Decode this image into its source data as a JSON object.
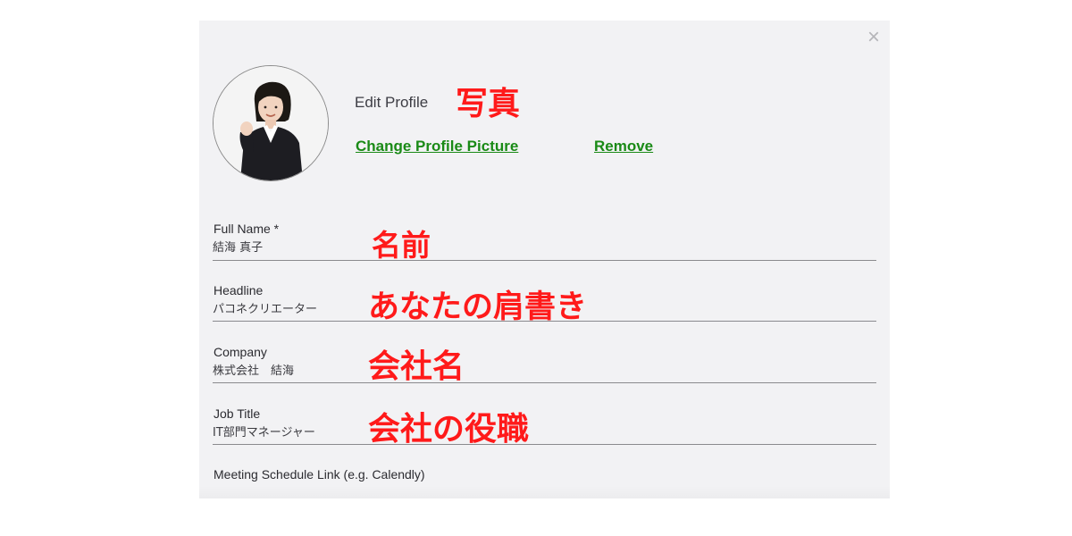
{
  "modal": {
    "close_symbol": "×",
    "title": "Edit Profile",
    "photo_annotation": "写真",
    "change_picture_label": "Change Profile Picture",
    "remove_label": "Remove"
  },
  "fields": [
    {
      "label": "Full Name *",
      "value": "結海 真子",
      "annotation": "名前"
    },
    {
      "label": "Headline",
      "value": "パコネクリエーター",
      "annotation": "あなたの肩書き"
    },
    {
      "label": "Company",
      "value": "株式会社　結海",
      "annotation": "会社名"
    },
    {
      "label": "Job Title",
      "value": "IT部門マネージャー",
      "annotation": "会社の役職"
    },
    {
      "label": "Meeting Schedule Link (e.g. Calendly)"
    }
  ],
  "colors": {
    "annotation": "#ff1a1a",
    "link": "#1a8a16",
    "modal_bg": "#f2f2f4"
  },
  "icons": {
    "close": "close-icon",
    "avatar": "profile-photo"
  }
}
